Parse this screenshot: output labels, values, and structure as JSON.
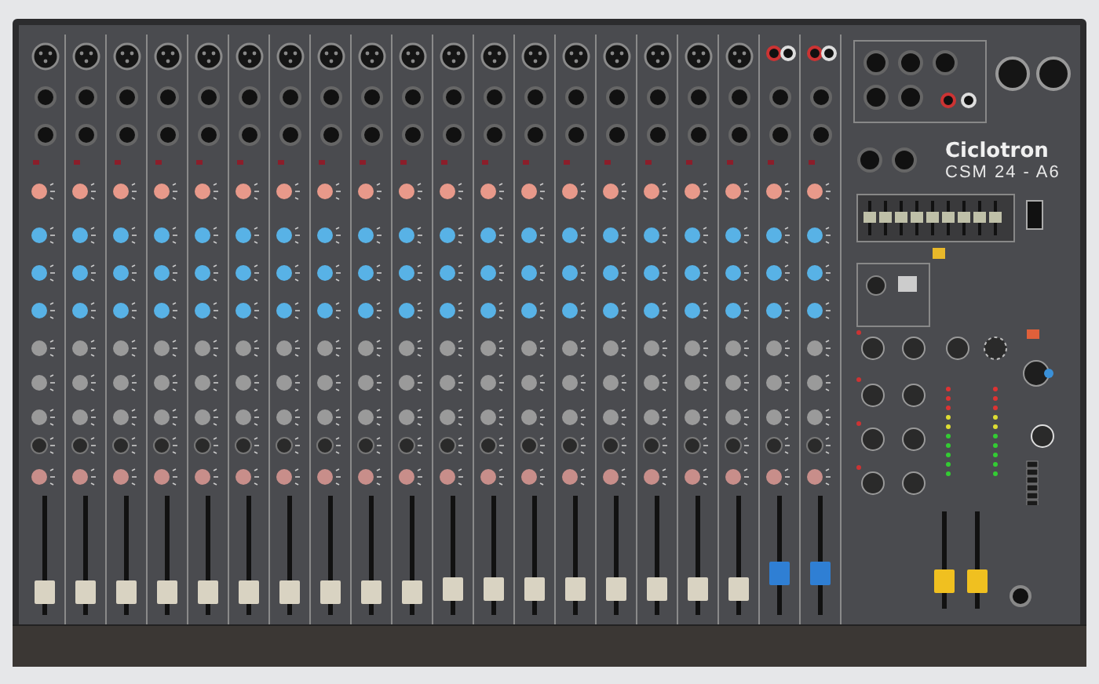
{
  "console": {
    "brand": "Ciclotron",
    "model": "CSM 24 - A6"
  },
  "channels": [
    {
      "kind": "mono",
      "level": 0.12
    },
    {
      "kind": "mono",
      "level": 0.12
    },
    {
      "kind": "mono",
      "level": 0.12
    },
    {
      "kind": "mono",
      "level": 0.12
    },
    {
      "kind": "mono",
      "level": 0.12
    },
    {
      "kind": "mono",
      "level": 0.12
    },
    {
      "kind": "mono",
      "level": 0.12
    },
    {
      "kind": "mono",
      "level": 0.12
    },
    {
      "kind": "mono",
      "level": 0.12
    },
    {
      "kind": "mono",
      "level": 0.12
    },
    {
      "kind": "mono",
      "level": 0.15
    },
    {
      "kind": "mono",
      "level": 0.15
    },
    {
      "kind": "mono",
      "level": 0.15
    },
    {
      "kind": "mono",
      "level": 0.15
    },
    {
      "kind": "mono",
      "level": 0.15
    },
    {
      "kind": "mono",
      "level": 0.15
    },
    {
      "kind": "mono",
      "level": 0.15
    },
    {
      "kind": "mono",
      "level": 0.15
    },
    {
      "kind": "stereo",
      "level": 0.3
    },
    {
      "kind": "stereo",
      "level": 0.3
    }
  ],
  "masters": [
    {
      "level": 0.2
    },
    {
      "level": 0.2
    }
  ]
}
